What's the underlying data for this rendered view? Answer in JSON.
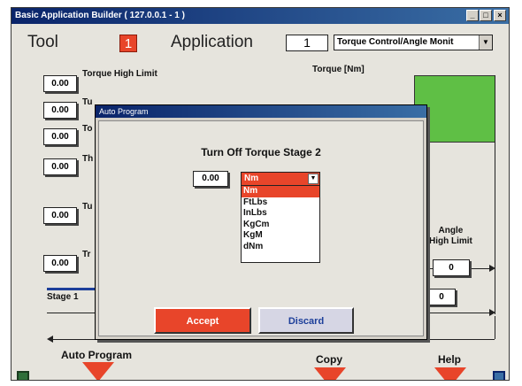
{
  "window": {
    "title": "Basic Application Builder  ( 127.0.0.1 - 1 )",
    "minimize": "_",
    "maximize": "□",
    "close": "×"
  },
  "header": {
    "tool_label": "Tool",
    "tool_number": "1",
    "application_label": "Application",
    "application_number": "1",
    "application_type": "Torque Control/Angle Monit"
  },
  "fields": [
    {
      "value": "0.00",
      "label": "Torque High Limit"
    },
    {
      "value": "0.00",
      "label": "Tu"
    },
    {
      "value": "0.00",
      "label": "To"
    },
    {
      "value": "0.00",
      "label": "Th"
    },
    {
      "value": "0.00",
      "label": "Tu"
    },
    {
      "value": "0.00",
      "label": "Tr"
    }
  ],
  "chart": {
    "torque_axis_label": "Torque [Nm]",
    "angle_high_limit_label": "Angle\nHigh Limit",
    "angle_high_limit_value": "0",
    "angle_value_2": "0",
    "stage_label": "Stage 1"
  },
  "bottom": {
    "auto_program": "Auto Program",
    "copy": "Copy",
    "help": "Help"
  },
  "dialog": {
    "title": "Auto Program",
    "heading": "Turn Off Torque Stage 2",
    "value": "0.00",
    "selected_unit": "Nm",
    "unit_options": [
      "Nm",
      "FtLbs",
      "InLbs",
      "KgCm",
      "KgM",
      "dNm"
    ],
    "accept": "Accept",
    "discard": "Discard"
  },
  "colors": {
    "accent_red": "#e8452a",
    "torque_green": "#5fbf45",
    "title_blue": "#0a246a"
  }
}
